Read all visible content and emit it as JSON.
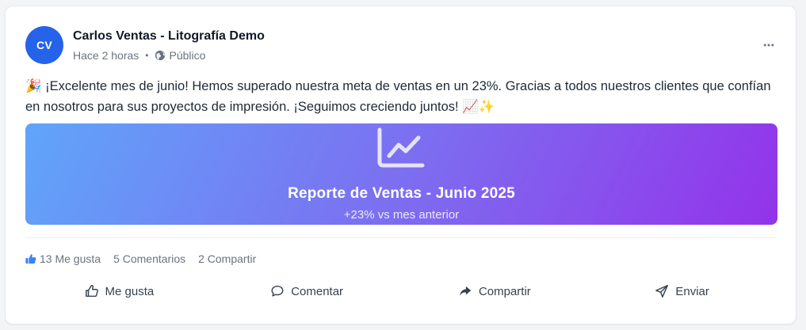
{
  "post": {
    "author_initials": "CV",
    "author_name": "Carlos Ventas - Litografía Demo",
    "time": "Hace 2 horas",
    "separator": "•",
    "visibility": "Público",
    "more_icon": "more-horizontal-icon",
    "text": "🎉 ¡Excelente mes de junio! Hemos superado nuestra meta de ventas en un 23%. Gracias a todos nuestros clientes que confían en nosotros para sus proyectos de impresión. ¡Seguimos creciendo juntos! 📈✨",
    "avatar_color": "#2563eb"
  },
  "banner": {
    "icon": "line-chart-icon",
    "title": "Reporte de Ventas - Junio 2025",
    "subtitle": "+23% vs mes anterior",
    "gradient_start": "#60a5fa",
    "gradient_end": "#9333ea"
  },
  "stats": {
    "likes": "13 Me gusta",
    "comments": "5 Comentarios",
    "shares": "2 Compartir",
    "like_color": "#3b82f6"
  },
  "actions": {
    "like": "Me gusta",
    "comment": "Comentar",
    "share": "Compartir",
    "send": "Enviar"
  }
}
